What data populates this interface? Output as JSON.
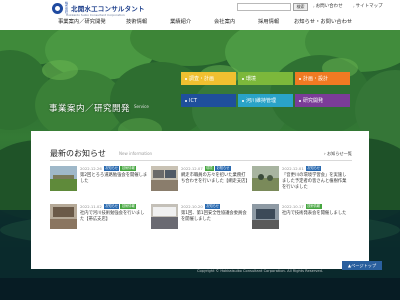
{
  "header": {
    "logo": {
      "kabu": "株式会社",
      "name": "北開水工コンサルタント",
      "sub": "Hokkaido Suiko Consultant Corporation"
    },
    "search": {
      "placeholder": "",
      "button_label": "検索"
    },
    "util_links": [
      {
        "label": "お問い合わせ"
      },
      {
        "label": "サイトマップ"
      }
    ],
    "nav": [
      {
        "label": "事業案内／研究開発"
      },
      {
        "label": "技術情報"
      },
      {
        "label": "業績紹介"
      },
      {
        "label": "会社案内"
      },
      {
        "label": "採用情報"
      },
      {
        "label": "お知らせ・お問い合わせ"
      }
    ]
  },
  "hero": {
    "title": "事業案内／研究開発",
    "subtitle": "Service",
    "menu": [
      {
        "label": "調査・計画",
        "color": "#f0c030"
      },
      {
        "label": "環境",
        "color": "#7cb83b"
      },
      {
        "label": "計画・設計",
        "color": "#f07a22"
      },
      {
        "label": "ICT",
        "color": "#1f4f9c"
      },
      {
        "label": "河川維持管理",
        "color": "#2aa3c8"
      },
      {
        "label": "研究開発",
        "color": "#7b3c98"
      }
    ]
  },
  "news": {
    "heading": "最新のお知らせ",
    "sub": "New information",
    "all_link": "お知らせ一覧",
    "tag_colors": {
      "blue": "#2a6ab0",
      "green": "#46a640",
      "orange": "#e4872a"
    },
    "items": [
      {
        "date": "2022.12.26",
        "tags": [
          "お知らせ",
          "技術情報"
        ],
        "title": "第2回とろろ道路勉強会を開催しました"
      },
      {
        "date": "2022.12.07",
        "tags": [
          "環境",
          "お知らせ"
        ],
        "title": "網走市職員の方々を招いた業務打ち合わせを行いました【網走支店】"
      },
      {
        "date": "2022.12.01",
        "tags": [
          "お知らせ"
        ],
        "title": "「音更川の環境学習会」を実施しました予定者の皆さんと植樹作業を行いました"
      },
      {
        "date": "2022.11.02",
        "tags": [
          "お知らせ",
          "技術情報"
        ],
        "title": "社内で河川技術勉強会を行いました【帯広支店】"
      },
      {
        "date": "2022.10.20",
        "tags": [
          "お知らせ"
        ],
        "title": "第1回、第1回安全性協議会委員会を開催しました"
      },
      {
        "date": "2022.10.17",
        "tags": [
          "技術情報"
        ],
        "title": "社内で技術発表会を開催しました"
      }
    ]
  },
  "footer": {
    "pagetop": "ページトップ",
    "copyright": "Copyright © Hokkaisuiko Consultant Corporation. All Rights Reserved."
  }
}
